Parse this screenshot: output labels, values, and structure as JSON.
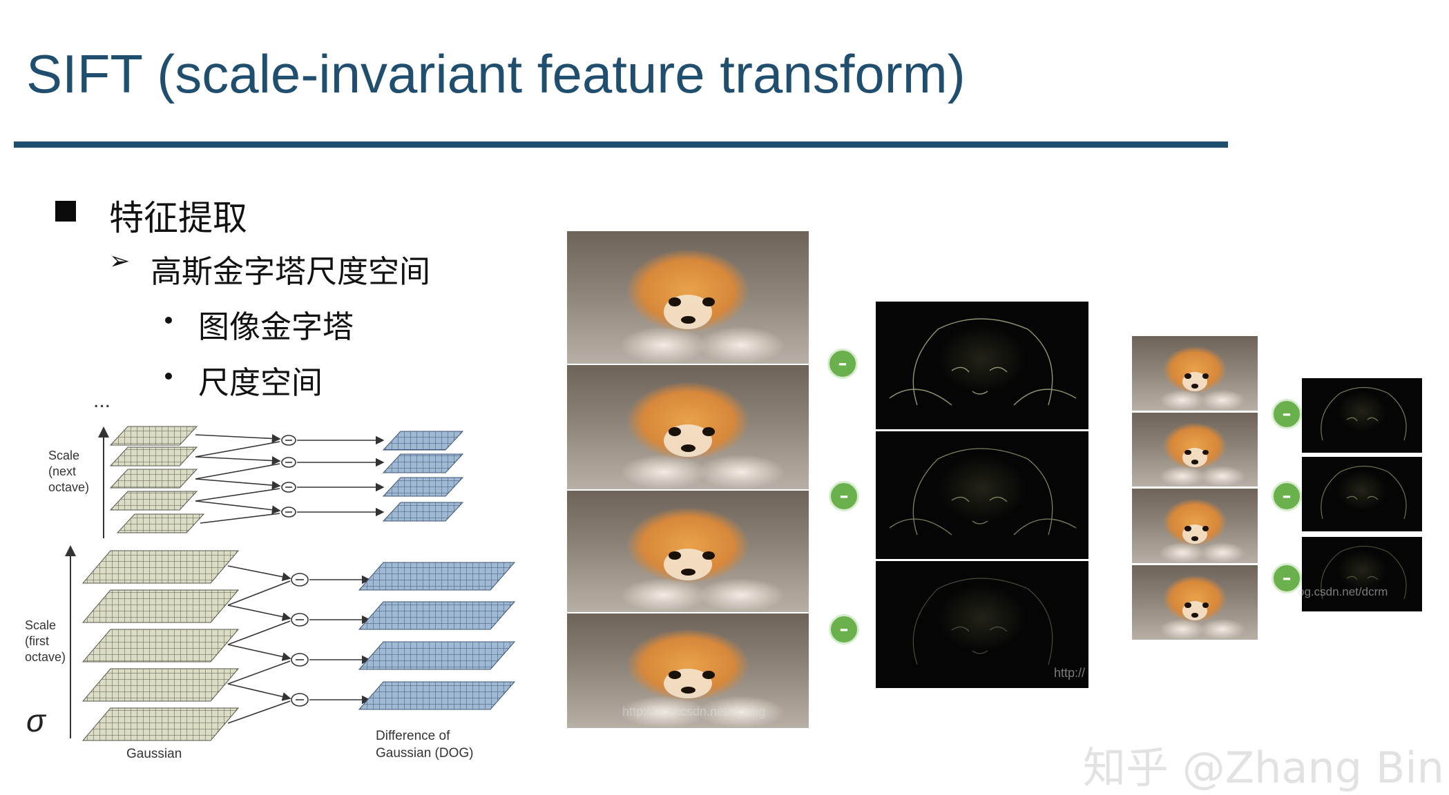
{
  "slide": {
    "title": "SIFT (scale-invariant feature transform)",
    "bullet_l1": "特征提取",
    "bullet_l2": "高斯金字塔尺度空间",
    "bullet_l3": [
      "图像金字塔",
      "尺度空间"
    ]
  },
  "diagram": {
    "ellipsis": "...",
    "scale_next": [
      "Scale",
      "(next",
      "octave)"
    ],
    "scale_first": [
      "Scale",
      "(first",
      "octave)"
    ],
    "sigma": "σ",
    "gaussian_label": "Gaussian",
    "dog_label": [
      "Difference of",
      "Gaussian (DOG)"
    ]
  },
  "figure": {
    "minus_symbol": "–",
    "faint_url_1": "http://blog.csdn.net/dcrmg",
    "faint_url_2": "http://",
    "faint_url_3": "og.csdn.net/dcrm"
  },
  "watermark": "知乎 @Zhang Bin",
  "colors": {
    "title_blue": "#1f4e6e",
    "minus_green": "#6ab04c",
    "gaussian_grid": "#c8c8a8",
    "dog_grid": "#7a9cc0"
  }
}
